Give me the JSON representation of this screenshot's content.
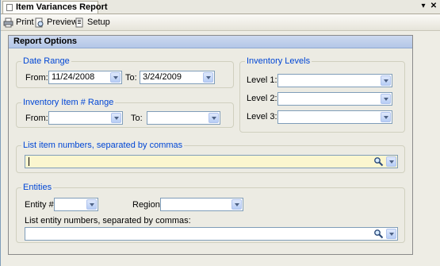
{
  "tab": {
    "title": "Item Variances Report"
  },
  "toolbar": {
    "print": "Print",
    "preview": "Preview",
    "setup": "Setup"
  },
  "panel": {
    "title": "Report Options"
  },
  "date_range": {
    "title": "Date Range",
    "from_label": "From:",
    "from_value": "11/24/2008",
    "to_label": "To:",
    "to_value": "3/24/2009"
  },
  "item_range": {
    "title": "Inventory Item # Range",
    "from_label": "From:",
    "from_value": "",
    "to_label": "To:",
    "to_value": ""
  },
  "inventory_levels": {
    "title": "Inventory Levels",
    "level1_label": "Level 1:",
    "level1_value": "",
    "level2_label": "Level 2:",
    "level2_value": "",
    "level3_label": "Level 3:",
    "level3_value": ""
  },
  "item_list": {
    "title": "List item numbers, separated by commas",
    "value": ""
  },
  "entities": {
    "title": "Entities",
    "entity_label": "Entity #:",
    "entity_value": "",
    "region_label": "Region:",
    "region_value": "",
    "list_label": "List entity numbers, separated by commas:",
    "list_value": ""
  },
  "icons": [
    "tab-report-icon",
    "dropdown-icon",
    "close-icon",
    "print-icon",
    "preview-icon",
    "setup-icon",
    "search-icon",
    "chevron-down-icon"
  ]
}
